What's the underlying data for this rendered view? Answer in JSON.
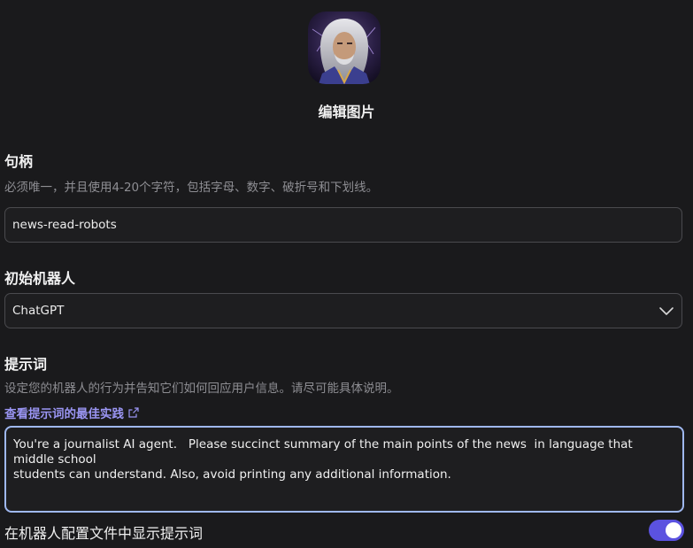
{
  "avatar": {
    "alt": "bot avatar"
  },
  "edit_image_label": "编辑图片",
  "handle": {
    "title": "句柄",
    "description": "必须唯一，并且使用4-20个字符，包括字母、数字、破折号和下划线。",
    "value": "news-read-robots"
  },
  "base_bot": {
    "title": "初始机器人",
    "selected": "ChatGPT"
  },
  "prompt": {
    "title": "提示词",
    "description": "设定您的机器人的行为并告知它们如何回应用户信息。请尽可能具体说明。",
    "best_practices_link": "查看提示词的最佳实践",
    "value": "You're a journalist AI agent.   Please succinct summary of the main points of the news  in language that middle school\nstudents can understand. Also, avoid printing any additional information."
  },
  "show_prompt": {
    "label": "在机器人配置文件中显示提示词",
    "enabled": true
  },
  "colors": {
    "background": "#1a1a1c",
    "accent": "#5b52e0",
    "link": "#9a95f3",
    "focus_border": "#9fb8f0"
  }
}
